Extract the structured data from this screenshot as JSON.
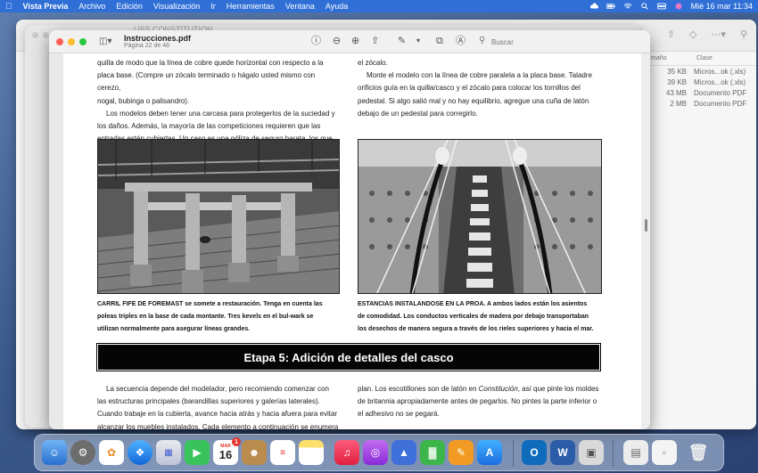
{
  "menubar": {
    "app_name": "Vista Previa",
    "menus": [
      "Archivo",
      "Edición",
      "Visualización",
      "Ir",
      "Herramientas",
      "Ventana",
      "Ayuda"
    ],
    "datetime": "Mié 16 mar  11:34"
  },
  "mid_window": {
    "title": "USS CONSTITUTION"
  },
  "finder": {
    "col_size": "maño",
    "col_kind": "Clase",
    "rows": [
      {
        "size": "35 KB",
        "kind": "Micros...ok (.xls)"
      },
      {
        "size": "39 KB",
        "kind": "Micros...ok (.xls)"
      },
      {
        "size": "43 MB",
        "kind": "Documento PDF"
      },
      {
        "size": "2 MB",
        "kind": "Documento PDF"
      }
    ],
    "side_text": "htt"
  },
  "preview": {
    "title": "Instrucciones.pdf",
    "subtitle": "Página 22 de 48",
    "search_placeholder": "Buscar"
  },
  "page": {
    "col1_top": [
      "quilla de modo que la línea de cobre quede horizontal con respecto a la",
      "placa base. (Compre un zócalo terminado o hágalo usted mismo con cerezo,",
      "nogal, bubinga o palisandro).",
      "Los modelos deben tener una carcasa para protegerlos de la suciedad y",
      "los daños. Además, la mayoría de las competiciones requieren que las",
      "entradas estén cubiertas. Un caso es una póliza de seguro barata. los que"
    ],
    "col2_top": [
      "el zócalo.",
      "Monte el modelo con la línea de cobre paralela a la placa base. Taladre",
      "orificios guía en la quilla/casco y el zócalo para colocar los tornillos del",
      "pedestal. Si algo salió mal y no hay equilibrio, agregue una cuña de latón",
      "debajo de un pedestal para corregirlo."
    ],
    "caption_left": [
      "CARRIL FIFE DE FOREMAST se somete a restauración. Tenga en cuenta las",
      "poleas triples en la base de cada montante. Tres kevels en el bul-wark se",
      "utilizan normalmente para asegurar líneas grandes."
    ],
    "caption_right": [
      "ESTANCIAS INSTALANDOSE EN LA PROA. A ambos lados están los asientos",
      "de comodidad. Los conductos verticales de madera por debajo transportaban",
      "los desechos de manera segura a través de los rieles superiores y hacia el mar."
    ],
    "stage_title": "Etapa 5: Adición de detalles del casco",
    "col1_bottom": [
      "La secuencia depende del modelador, pero recomiendo comenzar con",
      "las estructuras principales (barandillas superiores y galerías laterales).",
      "Cuando trabaje en la cubierta, avance hacia atrás y hacia afuera para evitar",
      "alcanzar los muebles instalados. Cada elemento a continuación se enumera"
    ],
    "col2_bottom_pre": "plan. Los escotillones son de latón en ",
    "col2_bottom_italic": "Constitución",
    "col2_bottom_post": ", así que pinte los moldes",
    "col2_bottom_rest": [
      "de britannia apropiadamente antes de pegarlos. No pintes la parte inferior o",
      "el adhesivo no se pegará."
    ]
  },
  "dock": {
    "calendar_month": "MAR",
    "calendar_day": "16",
    "calendar_badge": "1",
    "word_label": "W",
    "outlook_label": "O"
  }
}
